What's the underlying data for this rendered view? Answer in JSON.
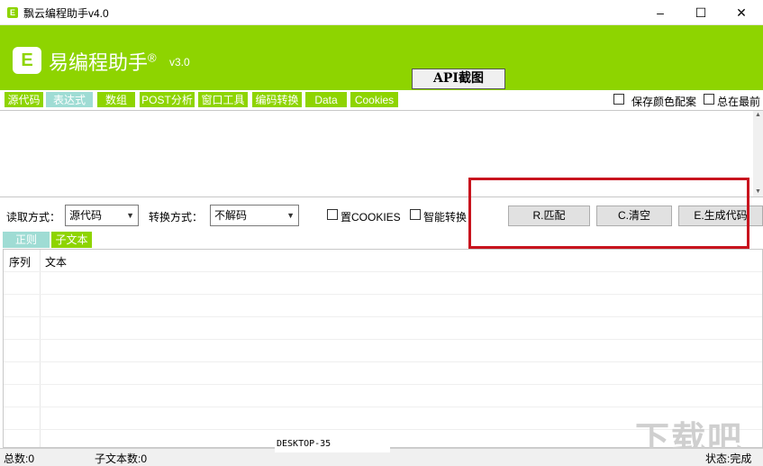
{
  "window": {
    "title": "飘云编程助手v4.0",
    "minimize": "–",
    "maximize": "☐",
    "close": "✕",
    "app_icon": "E"
  },
  "header": {
    "logo_letter": "E",
    "app_name": "易编程助手",
    "registered": "®",
    "version": "v3.0",
    "api_button": "API截图"
  },
  "tabs": [
    "源代码",
    "表达式",
    "数组",
    "POST分析",
    "窗口工具",
    "编码转换",
    "Data",
    "Cookies"
  ],
  "active_tab": "表达式",
  "options": {
    "save_colors": "保存颜色配案",
    "always_on_top": "总在最前"
  },
  "controls": {
    "read_mode_label": "读取方式：",
    "read_mode_value": "源代码",
    "convert_mode_label": "转换方式：",
    "convert_mode_value": "不解码",
    "set_cookies": "置COOKIES",
    "smart_convert": "智能转换",
    "match_button": "R.匹配",
    "clear_button": "C.清空",
    "generate_button": "E.生成代码"
  },
  "subtabs": [
    "正则",
    "子文本"
  ],
  "table": {
    "columns": [
      "序列",
      "文本"
    ]
  },
  "status": {
    "total": "总数:0",
    "sub_count": "子文本数:0",
    "desktop": "DESKTOP-35",
    "state": "状态:完成"
  },
  "watermark": "下载吧",
  "colors": {
    "brand_green": "#8ed400",
    "active_tab": "#9fdcd4",
    "highlight_red": "#c8141e"
  }
}
